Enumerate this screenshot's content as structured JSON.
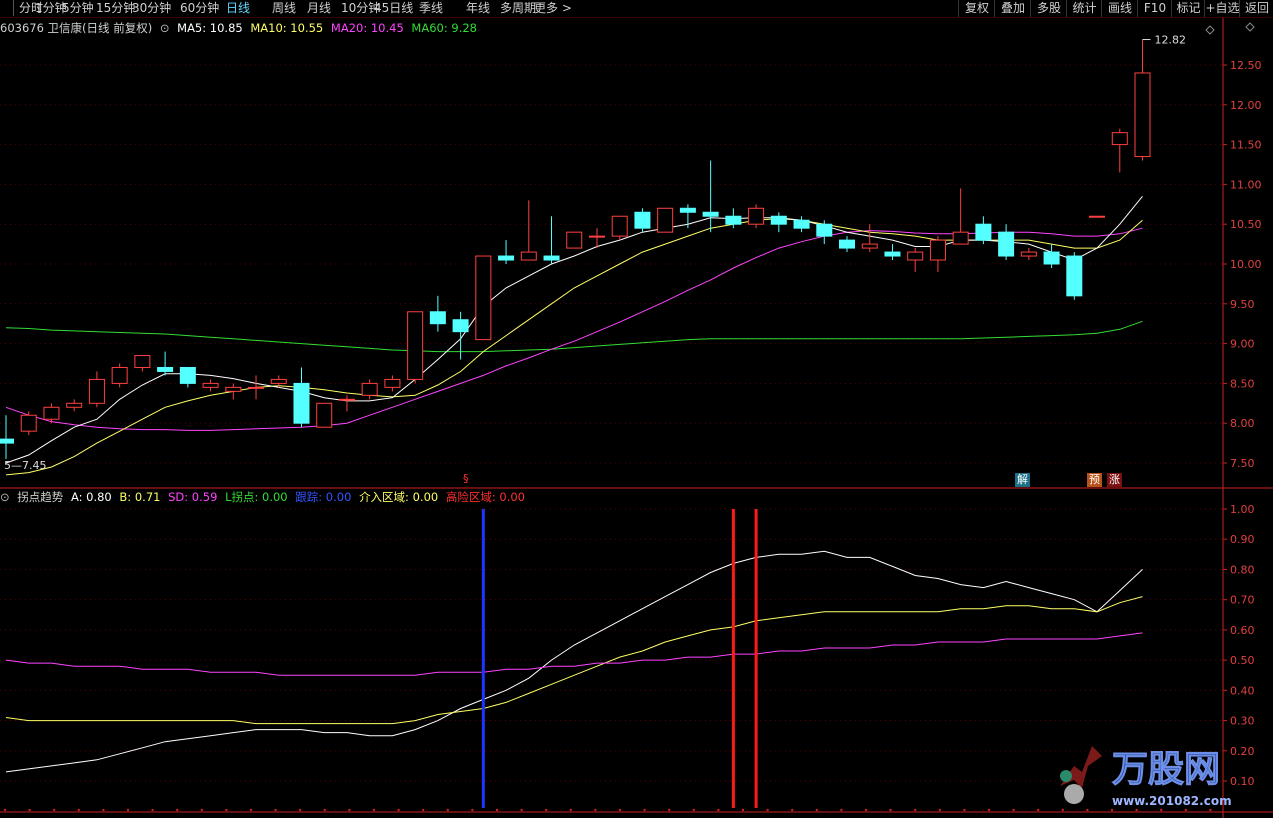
{
  "topbar": {
    "periods": [
      "分时",
      "1分钟",
      "5分钟",
      "15分钟",
      "30分钟",
      "60分钟",
      "日线",
      "周线",
      "月线",
      "10分钟",
      "45日线",
      "季线",
      "年线",
      "多周期",
      "更多 >"
    ],
    "active_period": "日线",
    "buttons": [
      "复权",
      "叠加",
      "多股",
      "统计",
      "画线",
      "F10",
      "标记",
      "+自选",
      "返回"
    ]
  },
  "main_legend": {
    "stock": "603676 卫信康(日线 前复权)",
    "ma5": "MA5: 10.85",
    "ma10": "MA10: 10.55",
    "ma20": "MA20: 10.45",
    "ma60": "MA60: 9.28"
  },
  "main_axis": {
    "ticks": [
      "12.50",
      "12.00",
      "11.50",
      "11.00",
      "10.50",
      "10.00",
      "9.50",
      "9.00",
      "8.50",
      "8.00",
      "7.50"
    ],
    "high_label": "12.82",
    "low_label": "7.45",
    "low_marker": "5"
  },
  "signals": {
    "s_marker": "§",
    "jie": "解",
    "yu": "预",
    "zhang": "涨"
  },
  "sub_legend": {
    "name": "拐点趋势",
    "a": "A: 0.80",
    "b": "B: 0.71",
    "sd": "SD: 0.59",
    "l": "L拐点: 0.00",
    "gen": "跟踪: 0.00",
    "jie": "介入区域: 0.00",
    "gao": "高险区域: 0.00"
  },
  "sub_axis": {
    "ticks": [
      "1.00",
      "0.90",
      "0.80",
      "0.70",
      "0.60",
      "0.50",
      "0.40",
      "0.30",
      "0.20",
      "0.10"
    ]
  },
  "watermark": {
    "brand": "万股网",
    "url": "www.201082.com"
  },
  "colors": {
    "up": "#ff4040",
    "down": "#54ffff",
    "ma5": "#ffffff",
    "ma10": "#ffff66",
    "ma20": "#ff44ff",
    "ma60": "#33dd33",
    "axis": "#cc2020"
  },
  "chart_data": [
    {
      "type": "candlestick",
      "title": "603676 卫信康(日线 前复权)",
      "ylim": [
        7.3,
        12.9
      ],
      "candles": [
        [
          7.8,
          8.1,
          7.75,
          7.55
        ],
        [
          7.9,
          8.15,
          8.1,
          7.85
        ],
        [
          8.05,
          8.25,
          8.2,
          8.0
        ],
        [
          8.2,
          8.3,
          8.25,
          8.15
        ],
        [
          8.25,
          8.65,
          8.55,
          8.2
        ],
        [
          8.5,
          8.75,
          8.7,
          8.45
        ],
        [
          8.7,
          8.85,
          8.85,
          8.65
        ],
        [
          8.7,
          8.9,
          8.65,
          8.6
        ],
        [
          8.7,
          8.7,
          8.5,
          8.45
        ],
        [
          8.45,
          8.55,
          8.5,
          8.4
        ],
        [
          8.4,
          8.5,
          8.45,
          8.3
        ],
        [
          8.45,
          8.6,
          8.45,
          8.3
        ],
        [
          8.5,
          8.6,
          8.55,
          8.45
        ],
        [
          8.5,
          8.7,
          8.0,
          7.95
        ],
        [
          7.95,
          8.25,
          8.25,
          7.95
        ],
        [
          8.3,
          8.35,
          8.3,
          8.15
        ],
        [
          8.35,
          8.55,
          8.5,
          8.3
        ],
        [
          8.45,
          8.6,
          8.55,
          8.4
        ],
        [
          8.55,
          9.4,
          9.4,
          8.5
        ],
        [
          9.4,
          9.6,
          9.25,
          9.15
        ],
        [
          9.3,
          9.4,
          9.15,
          8.8
        ],
        [
          9.05,
          10.1,
          10.1,
          9.05
        ],
        [
          10.1,
          10.3,
          10.05,
          10.0
        ],
        [
          10.05,
          10.8,
          10.15,
          10.05
        ],
        [
          10.1,
          10.6,
          10.05,
          10.0
        ],
        [
          10.2,
          10.4,
          10.4,
          10.2
        ],
        [
          10.35,
          10.45,
          10.35,
          10.2
        ],
        [
          10.35,
          10.6,
          10.6,
          10.3
        ],
        [
          10.65,
          10.7,
          10.45,
          10.4
        ],
        [
          10.4,
          10.7,
          10.7,
          10.4
        ],
        [
          10.7,
          10.75,
          10.65,
          10.45
        ],
        [
          10.65,
          11.3,
          10.6,
          10.4
        ],
        [
          10.6,
          10.7,
          10.5,
          10.45
        ],
        [
          10.5,
          10.75,
          10.7,
          10.45
        ],
        [
          10.6,
          10.65,
          10.5,
          10.4
        ],
        [
          10.55,
          10.6,
          10.45,
          10.4
        ],
        [
          10.5,
          10.55,
          10.35,
          10.25
        ],
        [
          10.3,
          10.35,
          10.2,
          10.15
        ],
        [
          10.2,
          10.5,
          10.25,
          10.15
        ],
        [
          10.15,
          10.25,
          10.1,
          10.05
        ],
        [
          10.05,
          10.2,
          10.15,
          9.9
        ],
        [
          10.05,
          10.35,
          10.3,
          9.9
        ],
        [
          10.25,
          10.95,
          10.4,
          10.25
        ],
        [
          10.5,
          10.6,
          10.3,
          10.25
        ],
        [
          10.4,
          10.5,
          10.1,
          10.05
        ],
        [
          10.1,
          10.2,
          10.15,
          10.05
        ],
        [
          10.15,
          10.25,
          10.0,
          9.95
        ],
        [
          10.1,
          10.15,
          9.6,
          9.55
        ],
        [
          10.6,
          10.6,
          10.6,
          10.6
        ],
        [
          11.5,
          11.7,
          11.65,
          11.15
        ],
        [
          11.35,
          12.82,
          12.4,
          11.3
        ]
      ],
      "ma5": [
        7.5,
        7.6,
        7.78,
        7.95,
        8.05,
        8.3,
        8.48,
        8.62,
        8.62,
        8.6,
        8.56,
        8.5,
        8.45,
        8.4,
        8.32,
        8.28,
        8.28,
        8.32,
        8.55,
        8.8,
        9.06,
        9.47,
        9.7,
        9.85,
        10.0,
        10.1,
        10.22,
        10.3,
        10.4,
        10.45,
        10.5,
        10.58,
        10.57,
        10.58,
        10.58,
        10.55,
        10.48,
        10.4,
        10.35,
        10.3,
        10.22,
        10.22,
        10.3,
        10.3,
        10.28,
        10.25,
        10.15,
        10.05,
        10.2,
        10.5,
        10.85
      ],
      "ma10": [
        7.35,
        7.38,
        7.45,
        7.58,
        7.75,
        7.9,
        8.05,
        8.2,
        8.28,
        8.35,
        8.4,
        8.45,
        8.47,
        8.45,
        8.42,
        8.38,
        8.35,
        8.33,
        8.35,
        8.48,
        8.65,
        8.9,
        9.1,
        9.3,
        9.5,
        9.7,
        9.85,
        10.0,
        10.15,
        10.25,
        10.35,
        10.45,
        10.5,
        10.55,
        10.57,
        10.55,
        10.5,
        10.45,
        10.4,
        10.38,
        10.35,
        10.3,
        10.3,
        10.3,
        10.3,
        10.3,
        10.25,
        10.2,
        10.2,
        10.3,
        10.55
      ],
      "ma20": [
        8.2,
        8.1,
        8.02,
        7.98,
        7.95,
        7.93,
        7.92,
        7.92,
        7.91,
        7.91,
        7.92,
        7.93,
        7.94,
        7.95,
        7.97,
        8.0,
        8.1,
        8.2,
        8.3,
        8.4,
        8.5,
        8.6,
        8.72,
        8.82,
        8.93,
        9.03,
        9.15,
        9.27,
        9.4,
        9.53,
        9.67,
        9.8,
        9.95,
        10.08,
        10.2,
        10.28,
        10.35,
        10.4,
        10.42,
        10.41,
        10.39,
        10.38,
        10.38,
        10.39,
        10.4,
        10.4,
        10.38,
        10.35,
        10.35,
        10.38,
        10.45
      ],
      "ma60": [
        9.2,
        9.19,
        9.17,
        9.16,
        9.15,
        9.14,
        9.13,
        9.12,
        9.1,
        9.08,
        9.06,
        9.04,
        9.02,
        9.0,
        8.98,
        8.96,
        8.94,
        8.92,
        8.91,
        8.9,
        8.9,
        8.9,
        8.91,
        8.92,
        8.93,
        8.95,
        8.97,
        8.99,
        9.01,
        9.03,
        9.05,
        9.06,
        9.06,
        9.06,
        9.06,
        9.06,
        9.06,
        9.06,
        9.06,
        9.06,
        9.06,
        9.06,
        9.06,
        9.07,
        9.08,
        9.09,
        9.1,
        9.11,
        9.13,
        9.18,
        9.28
      ]
    },
    {
      "type": "line",
      "title": "拐点趋势",
      "ylim": [
        0.08,
        1.05
      ],
      "x": [
        0,
        1,
        2,
        3,
        4,
        5,
        6,
        7,
        8,
        9,
        10,
        11,
        12,
        13,
        14,
        15,
        16,
        17,
        18,
        19,
        20,
        21,
        22,
        23,
        24,
        25,
        26,
        27,
        28,
        29,
        30,
        31,
        32,
        33,
        34,
        35,
        36,
        37,
        38,
        39,
        40,
        41,
        42,
        43,
        44,
        45,
        46,
        47,
        48,
        49,
        50
      ],
      "series": [
        {
          "name": "A",
          "values": [
            0.13,
            0.14,
            0.15,
            0.16,
            0.17,
            0.19,
            0.21,
            0.23,
            0.24,
            0.25,
            0.26,
            0.27,
            0.27,
            0.27,
            0.26,
            0.26,
            0.25,
            0.25,
            0.27,
            0.3,
            0.34,
            0.37,
            0.4,
            0.44,
            0.5,
            0.55,
            0.59,
            0.63,
            0.67,
            0.71,
            0.75,
            0.79,
            0.82,
            0.84,
            0.85,
            0.85,
            0.86,
            0.84,
            0.84,
            0.81,
            0.78,
            0.77,
            0.75,
            0.74,
            0.76,
            0.74,
            0.72,
            0.7,
            0.66,
            0.73,
            0.8
          ]
        },
        {
          "name": "B",
          "values": [
            0.31,
            0.3,
            0.3,
            0.3,
            0.3,
            0.3,
            0.3,
            0.3,
            0.3,
            0.3,
            0.3,
            0.29,
            0.29,
            0.29,
            0.29,
            0.29,
            0.29,
            0.29,
            0.3,
            0.32,
            0.33,
            0.34,
            0.36,
            0.39,
            0.42,
            0.45,
            0.48,
            0.51,
            0.53,
            0.56,
            0.58,
            0.6,
            0.61,
            0.63,
            0.64,
            0.65,
            0.66,
            0.66,
            0.66,
            0.66,
            0.66,
            0.66,
            0.67,
            0.67,
            0.68,
            0.68,
            0.67,
            0.67,
            0.66,
            0.69,
            0.71
          ]
        },
        {
          "name": "SD",
          "values": [
            0.5,
            0.49,
            0.49,
            0.48,
            0.48,
            0.48,
            0.47,
            0.47,
            0.47,
            0.46,
            0.46,
            0.46,
            0.45,
            0.45,
            0.45,
            0.45,
            0.45,
            0.45,
            0.45,
            0.46,
            0.46,
            0.46,
            0.47,
            0.47,
            0.48,
            0.48,
            0.49,
            0.49,
            0.5,
            0.5,
            0.51,
            0.51,
            0.52,
            0.52,
            0.53,
            0.53,
            0.54,
            0.54,
            0.54,
            0.55,
            0.55,
            0.56,
            0.56,
            0.56,
            0.57,
            0.57,
            0.57,
            0.57,
            0.57,
            0.58,
            0.59
          ]
        }
      ],
      "signal_bars": [
        {
          "color": "blue",
          "x": 21
        },
        {
          "color": "red",
          "x": 32
        },
        {
          "color": "red",
          "x": 33
        }
      ]
    }
  ]
}
